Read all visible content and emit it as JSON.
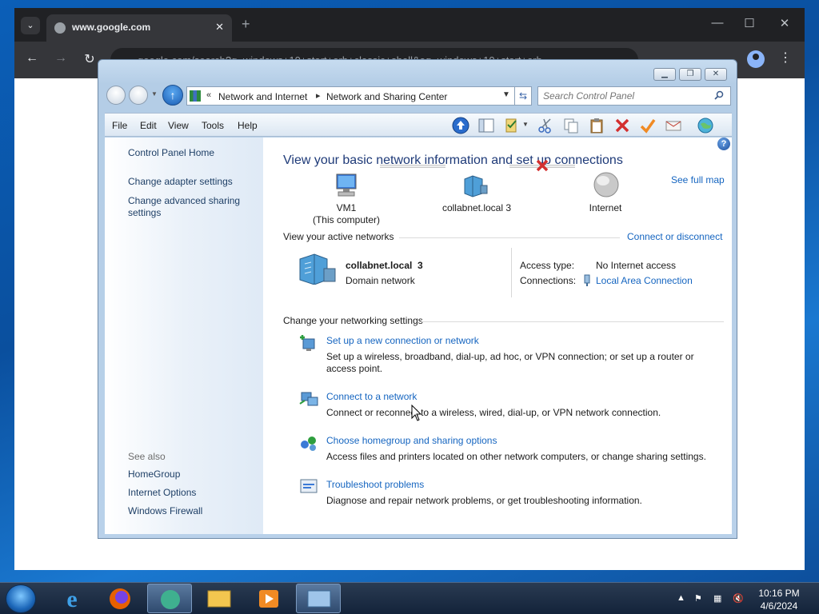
{
  "browser": {
    "tab_title": "www.google.com",
    "new_tab": "+",
    "url": "google.com/search?q=windows+10+start+orb+classic+shell&oq=windows+10+start+orb"
  },
  "window": {
    "address": {
      "crumb_prefix": "«",
      "crumb1": "Network and Internet",
      "crumb_sep": "▸",
      "crumb2": "Network and Sharing Center"
    },
    "search_placeholder": "Search Control Panel",
    "menu": [
      "File",
      "Edit",
      "View",
      "Tools",
      "Help"
    ]
  },
  "leftpane": {
    "links": [
      "Control Panel Home",
      "Change adapter settings",
      "Change advanced sharing settings"
    ],
    "see_also_label": "See also",
    "see_also": [
      "HomeGroup",
      "Internet Options",
      "Windows Firewall"
    ]
  },
  "main": {
    "title": "View your basic network information and set up connections",
    "see_full_map": "See full map",
    "map": {
      "computer_name": "VM1",
      "computer_sub": "(This computer)",
      "network_name": "collabnet.local  3",
      "internet": "Internet"
    },
    "active_networks_label": "View your active networks",
    "connect_disconnect": "Connect or disconnect",
    "active_network": {
      "name": "collabnet.local  3",
      "type": "Domain network",
      "access_type_label": "Access type:",
      "access_type_value": "No Internet access",
      "connections_label": "Connections:",
      "connections_value": "Local Area Connection"
    },
    "settings_label": "Change your networking settings",
    "tasks": [
      {
        "title": "Set up a new connection or network",
        "desc": "Set up a wireless, broadband, dial-up, ad hoc, or VPN connection; or set up a router or access point."
      },
      {
        "title": "Connect to a network",
        "desc": "Connect or reconnect to a wireless, wired, dial-up, or VPN network connection."
      },
      {
        "title": "Choose homegroup and sharing options",
        "desc": "Access files and printers located on other network computers, or change sharing settings."
      },
      {
        "title": "Troubleshoot problems",
        "desc": "Diagnose and repair network problems, or get troubleshooting information."
      }
    ]
  },
  "taskbar": {
    "time": "10:16 PM",
    "date": "4/6/2024"
  },
  "colors": {
    "link": "#1565c0",
    "title": "#1e3a78",
    "disconnect_x": "#d32f2f"
  }
}
